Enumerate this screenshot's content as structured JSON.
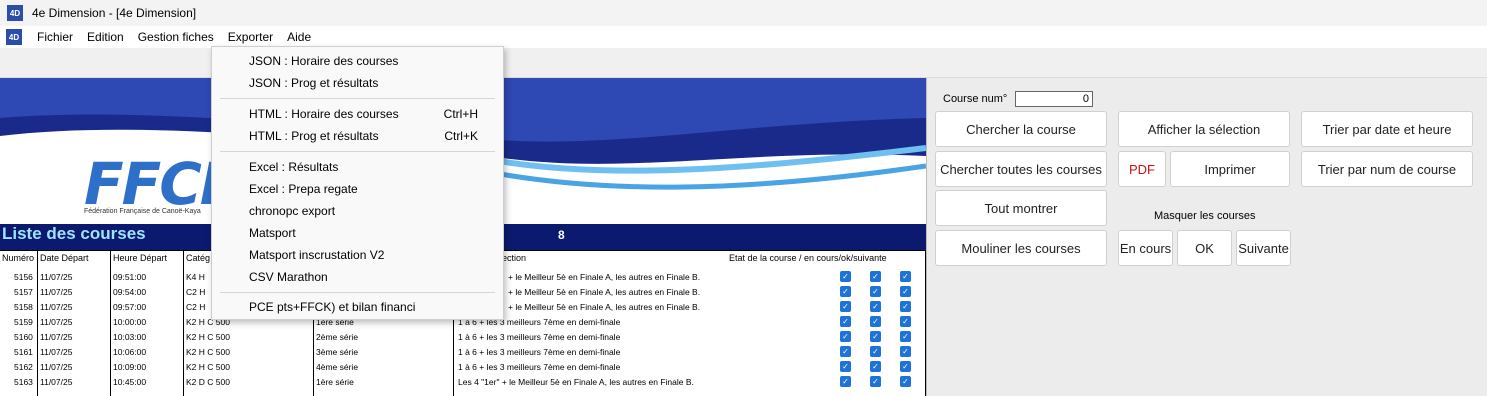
{
  "window": {
    "title": "4e Dimension - [4e Dimension]",
    "app_icon": "4D"
  },
  "menubar": {
    "icon": "4D",
    "items": [
      {
        "label": "Fichier"
      },
      {
        "label": "Edition"
      },
      {
        "label": "Gestion fiches"
      },
      {
        "label": "Exporter"
      },
      {
        "label": "Aide"
      }
    ]
  },
  "export_menu": {
    "items": [
      {
        "label": "JSON : Horaire des courses",
        "shortcut": ""
      },
      {
        "label": "JSON : Prog et résultats",
        "shortcut": ""
      },
      {
        "label": "HTML : Horaire des courses",
        "shortcut": "Ctrl+H"
      },
      {
        "label": "HTML : Prog et résultats",
        "shortcut": "Ctrl+K"
      },
      {
        "label": "Excel : Résultats",
        "shortcut": ""
      },
      {
        "label": "Excel : Prepa regate",
        "shortcut": ""
      },
      {
        "label": "chronopc export",
        "shortcut": ""
      },
      {
        "label": "Matsport",
        "shortcut": ""
      },
      {
        "label": "Matsport inscrustation V2",
        "shortcut": ""
      },
      {
        "label": "CSV Marathon",
        "shortcut": ""
      },
      {
        "label": "PCE pts+FFCK) et bilan financi",
        "shortcut": ""
      }
    ]
  },
  "banner": {
    "logo_text": "FFCK",
    "logo_subtitle": "Fédération Française de Canoë-Kaya",
    "brand_colors": {
      "navy": "#0b1a6e",
      "blue": "#2e6fc8",
      "light_blue": "#5fb4e8"
    }
  },
  "list": {
    "title": "Liste des courses",
    "count": "8",
    "columns": [
      "Numéro",
      "Date Départ",
      "Heure Départ",
      "Catég",
      "élection",
      "Etat de la course / en cours/ok/suivante"
    ],
    "rows": [
      {
        "num": "5156",
        "date": "11/07/25",
        "heure": "09:51:00",
        "cat": "K4 H",
        "serie": "",
        "selection": "+ le Meilleur 5è en Finale A, les autres en Finale B."
      },
      {
        "num": "5157",
        "date": "11/07/25",
        "heure": "09:54:00",
        "cat": "C2 H",
        "serie": "",
        "selection": "+ le Meilleur 5è en Finale A, les autres en Finale B."
      },
      {
        "num": "5158",
        "date": "11/07/25",
        "heure": "09:57:00",
        "cat": "C2 H",
        "serie": "",
        "selection": "+ le Meilleur 5è en Finale A, les autres en Finale B."
      },
      {
        "num": "5159",
        "date": "11/07/25",
        "heure": "10:00:00",
        "cat": "K2 H C 500",
        "serie": "1ère série",
        "selection": "1 à 6 + les 3 meilleurs 7ème en demi-finale"
      },
      {
        "num": "5160",
        "date": "11/07/25",
        "heure": "10:03:00",
        "cat": "K2 H C 500",
        "serie": "2ème série",
        "selection": "1 à 6 + les 3 meilleurs 7ème en demi-finale"
      },
      {
        "num": "5161",
        "date": "11/07/25",
        "heure": "10:06:00",
        "cat": "K2 H C 500",
        "serie": "3ème série",
        "selection": "1 à 6 + les 3 meilleurs 7ème en demi-finale"
      },
      {
        "num": "5162",
        "date": "11/07/25",
        "heure": "10:09:00",
        "cat": "K2 H C 500",
        "serie": "4ème série",
        "selection": "1 à 6 + les 3 meilleurs 7ème en demi-finale"
      },
      {
        "num": "5163",
        "date": "11/07/25",
        "heure": "10:45:00",
        "cat": "K2 D C 500",
        "serie": "1ère série",
        "selection": "Les 4 \"1er\" + le Meilleur 5è en Finale A, les autres en Finale B."
      }
    ]
  },
  "right_panel": {
    "course_num_label": "Course num°",
    "course_num_value": "0",
    "buttons": {
      "chercher": "Chercher la course",
      "afficher": "Afficher la sélection",
      "trier_date": "Trier par date et heure",
      "chercher_toutes": "Chercher toutes les courses",
      "pdf": "PDF",
      "imprimer": "Imprimer",
      "trier_num": "Trier par num de course",
      "tout_montrer": "Tout montrer",
      "mouliner": "Mouliner les courses",
      "en_cours": "En cours",
      "ok": "OK",
      "suivante": "Suivante"
    },
    "masquer_label": "Masquer les courses"
  }
}
